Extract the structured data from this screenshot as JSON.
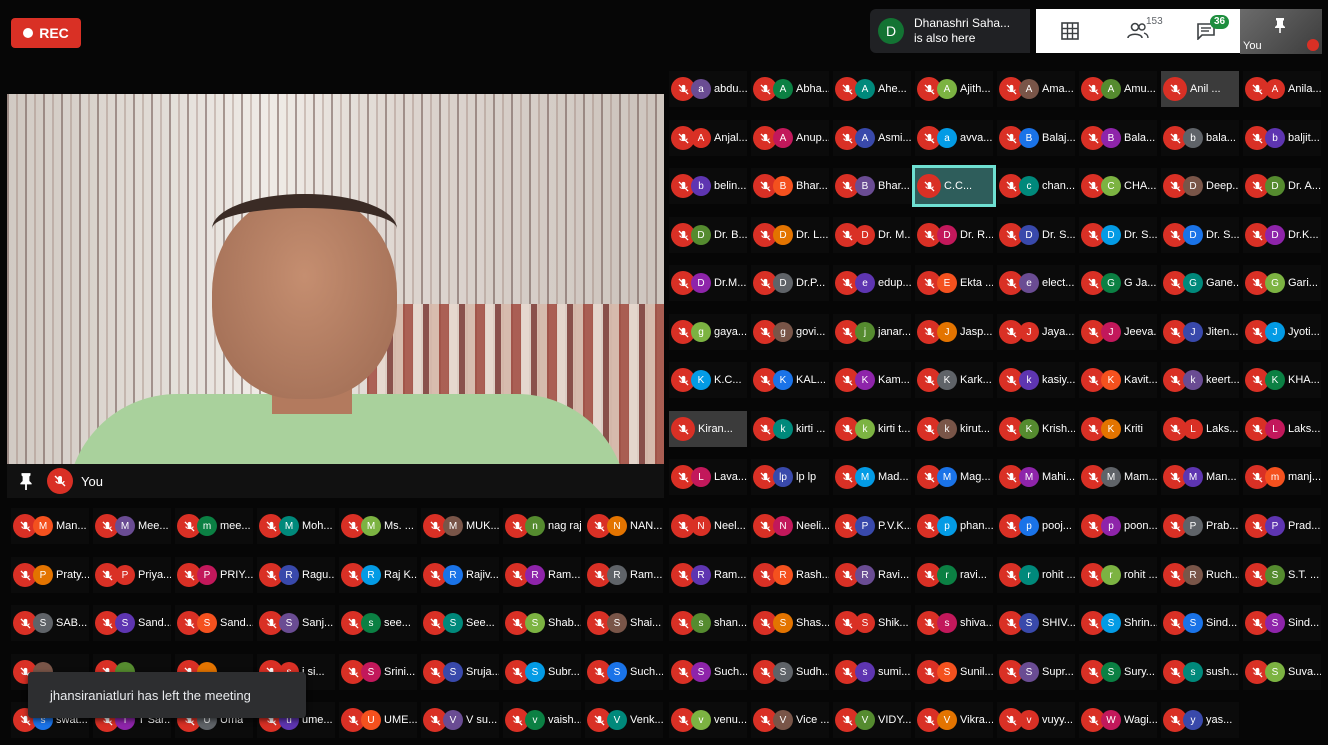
{
  "rec": {
    "label": "REC",
    "color": "#d93025"
  },
  "presence": {
    "initial": "D",
    "line1": "Dhanashri Saha...",
    "line2": "is also here"
  },
  "toolbar": {
    "participants_count": "153",
    "chat_badge": "36",
    "icons": [
      "grid-icon",
      "people-icon",
      "chat-icon"
    ]
  },
  "self_tile": {
    "label": "You"
  },
  "main_speaker": {
    "name": "You"
  },
  "toast": {
    "text": "jhansiraniatluri has left the meeting"
  },
  "accent": {
    "mic_off": "#d93025",
    "highlight": "#6ee0d2"
  },
  "participants": [
    [
      "abdu...",
      "Abha...",
      "Ahe...",
      "Ajith...",
      "Ama...",
      "Amu...",
      "Anil ...",
      "Anila..."
    ],
    [
      "Anjal...",
      "Anup...",
      "Asmi...",
      "avva...",
      "Balaj...",
      "Bala...",
      "bala...",
      "baljit..."
    ],
    [
      "belin...",
      "Bhar...",
      "Bhar...",
      "C.C...",
      "chan...",
      "CHA...",
      "Deep...",
      "Dr. A..."
    ],
    [
      "Dr. B...",
      "Dr. L...",
      "Dr. M...",
      "Dr. R...",
      "Dr. S...",
      "Dr. S...",
      "Dr. S...",
      "Dr.K..."
    ],
    [
      "Dr.M...",
      "Dr.P...",
      "edup...",
      "Ekta ...",
      "elect...",
      "G Ja...",
      "Gane...",
      "Gari..."
    ],
    [
      "gaya...",
      "govi...",
      "janar...",
      "Jasp...",
      "Jaya...",
      "Jeeva...",
      "Jiten...",
      "Jyoti..."
    ],
    [
      "K.C...",
      "KAL...",
      "Kam...",
      "Kark...",
      "kasiy...",
      "Kavit...",
      "keert...",
      "KHA..."
    ],
    [
      "Kiran...",
      "kirti ...",
      "kirti t...",
      "kirut...",
      "Krish...",
      "Kriti",
      "Laks...",
      "Laks..."
    ],
    [
      "Lava...",
      "lp lp",
      "Mad...",
      "Mag...",
      "Mahi...",
      "Mam...",
      "Man...",
      "manj..."
    ],
    [
      "Man...",
      "Mee...",
      "mee...",
      "Moh...",
      "Ms. ...",
      "MUK...",
      "nag raj",
      "NAN...",
      "Neel...",
      "Neeli...",
      "P.V.K...",
      "phan...",
      "pooj...",
      "poon...",
      "Prab...",
      "Prad..."
    ],
    [
      "Praty...",
      "Priya...",
      "PRIY...",
      "Ragu...",
      "Raj K...",
      "Rajiv...",
      "Ram...",
      "Ram...",
      "Ram...",
      "Rash...",
      "Ravi...",
      "ravi...",
      "rohit ...",
      "rohit ...",
      "Ruch...",
      "S.T. ..."
    ],
    [
      "SAB...",
      "Sand...",
      "Sand...",
      "Sanj...",
      "see...",
      "See...",
      "Shab...",
      "Shai...",
      "shan...",
      "Shas...",
      "Shik...",
      "shiva...",
      "SHIV...",
      "Shrin...",
      "Sind...",
      "Sind..."
    ],
    [
      "",
      "",
      "",
      "i si...",
      "Srini...",
      "Sruja...",
      "Subr...",
      "Such...",
      "Such...",
      "Sudh...",
      "sumi...",
      "Sunil...",
      "Supr...",
      "Sury...",
      "sush...",
      "Suva..."
    ],
    [
      "swat...",
      "T Sar...",
      "Uma",
      "ume...",
      "UME...",
      "V su...",
      "vaish...",
      "Venk...",
      "venu...",
      "Vice ...",
      "VIDY...",
      "Vikra...",
      "vuyy...",
      "Wagi...",
      "yas..."
    ]
  ],
  "avatar_letters": [
    [
      "a",
      "A",
      "A",
      "A",
      "A",
      "A",
      "",
      "A"
    ],
    [
      "A",
      "A",
      "A",
      "a",
      "B",
      "B",
      "b",
      "b"
    ],
    [
      "b",
      "B",
      "B",
      "",
      "c",
      "C",
      "D",
      "D"
    ],
    [
      "D",
      "D",
      "D",
      "D",
      "D",
      "D",
      "D",
      "D"
    ],
    [
      "D",
      "D",
      "e",
      "E",
      "e",
      "G",
      "G",
      "G"
    ],
    [
      "g",
      "g",
      "j",
      "J",
      "J",
      "J",
      "J",
      "J"
    ],
    [
      "K",
      "K",
      "K",
      "K",
      "k",
      "K",
      "k",
      "K"
    ],
    [
      "",
      "k",
      "k",
      "k",
      "K",
      "K",
      "L",
      "L"
    ],
    [
      "L",
      "lp",
      "M",
      "M",
      "M",
      "M",
      "M",
      "m"
    ],
    [
      "M",
      "M",
      "m",
      "M",
      "M",
      "M",
      "n",
      "N",
      "N",
      "N",
      "P",
      "p",
      "p",
      "p",
      "P",
      "P"
    ],
    [
      "P",
      "P",
      "P",
      "R",
      "R",
      "R",
      "R",
      "R",
      "R",
      "R",
      "R",
      "r",
      "r",
      "r",
      "R",
      "S"
    ],
    [
      "S",
      "S",
      "S",
      "S",
      "s",
      "S",
      "S",
      "S",
      "s",
      "S",
      "S",
      "s",
      "S",
      "S",
      "S",
      "S"
    ],
    [
      "",
      "",
      "",
      "s",
      "S",
      "S",
      "S",
      "S",
      "S",
      "S",
      "s",
      "S",
      "S",
      "S",
      "s",
      "S"
    ],
    [
      "s",
      "T",
      "U",
      "u",
      "U",
      "V",
      "v",
      "V",
      "v",
      "V",
      "V",
      "V",
      "v",
      "W",
      "y"
    ]
  ],
  "avatar_colors": [
    "#6a4c93",
    "#1a73e8",
    "#e37400",
    "#0b8043",
    "#8e24aa",
    "#d93025",
    "#00897b",
    "#5f6368",
    "#c2185b",
    "#7cb342",
    "#5e35b1",
    "#3949ab",
    "#795548",
    "#f4511e",
    "#039be5",
    "#558b2f"
  ]
}
